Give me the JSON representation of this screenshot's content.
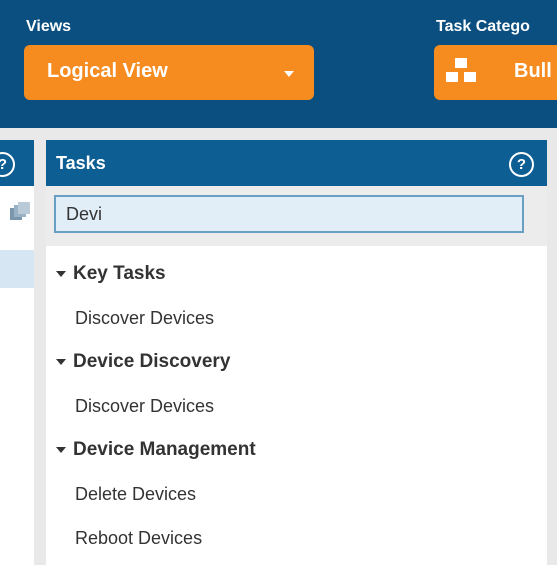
{
  "header": {
    "views_label": "Views",
    "view_button_label": "Logical View",
    "task_category_label": "Task Catego",
    "category_button_label": "Bull"
  },
  "left_panel": {
    "help_icon": "?"
  },
  "tasks_panel": {
    "title": "Tasks",
    "help_icon": "?",
    "search": {
      "value": "Devi",
      "placeholder": ""
    },
    "groups": [
      {
        "label": "Key Tasks",
        "items": [
          "Discover Devices"
        ]
      },
      {
        "label": "Device Discovery",
        "items": [
          "Discover Devices"
        ]
      },
      {
        "label": "Device Management",
        "items": [
          "Delete Devices",
          "Reboot Devices"
        ]
      }
    ]
  },
  "colors": {
    "topbar": "#0a4f80",
    "panel_header": "#0d5e93",
    "accent_orange": "#f68b1f",
    "search_bg": "#e2eef7"
  },
  "icons": {
    "dropdown": "caret-down-icon",
    "category": "hierarchy-icon",
    "help": "question-circle-icon",
    "left_stack": "stacked-windows-icon",
    "expand": "expanded-triangle-icon"
  }
}
